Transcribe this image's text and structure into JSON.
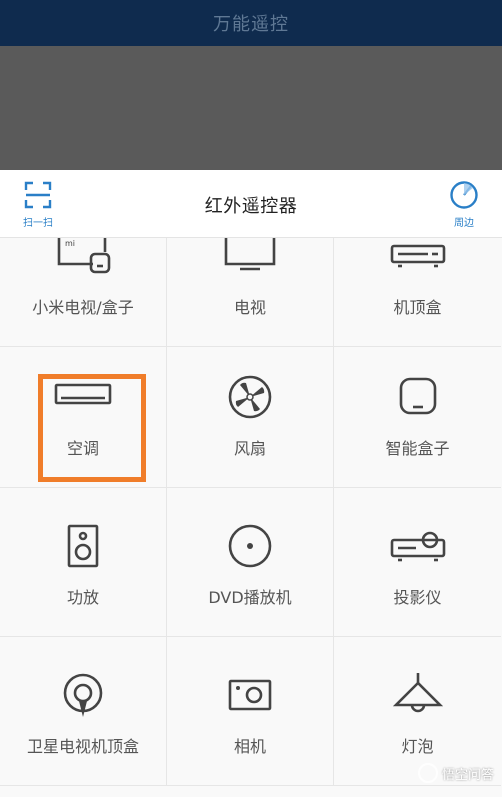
{
  "app_bar": {
    "title": "万能遥控"
  },
  "header": {
    "title": "红外遥控器",
    "scan_label": "扫一扫",
    "nearby_label": "周边"
  },
  "devices": [
    {
      "label": "小米电视/盒子",
      "icon": "mi-tv-box-icon"
    },
    {
      "label": "电视",
      "icon": "tv-icon"
    },
    {
      "label": "机顶盒",
      "icon": "set-top-box-icon"
    },
    {
      "label": "空调",
      "icon": "air-conditioner-icon"
    },
    {
      "label": "风扇",
      "icon": "fan-icon"
    },
    {
      "label": "智能盒子",
      "icon": "smart-box-icon"
    },
    {
      "label": "功放",
      "icon": "amplifier-icon"
    },
    {
      "label": "DVD播放机",
      "icon": "dvd-player-icon"
    },
    {
      "label": "投影仪",
      "icon": "projector-icon"
    },
    {
      "label": "卫星电视机顶盒",
      "icon": "satellite-box-icon"
    },
    {
      "label": "相机",
      "icon": "camera-icon"
    },
    {
      "label": "灯泡",
      "icon": "lamp-icon"
    }
  ],
  "highlighted_device": "空调",
  "colors": {
    "app_bar": "#0f2b4e",
    "accent": "#2a7fc7",
    "highlight": "#f07d2a"
  },
  "watermark": {
    "text": "悟空问答"
  }
}
